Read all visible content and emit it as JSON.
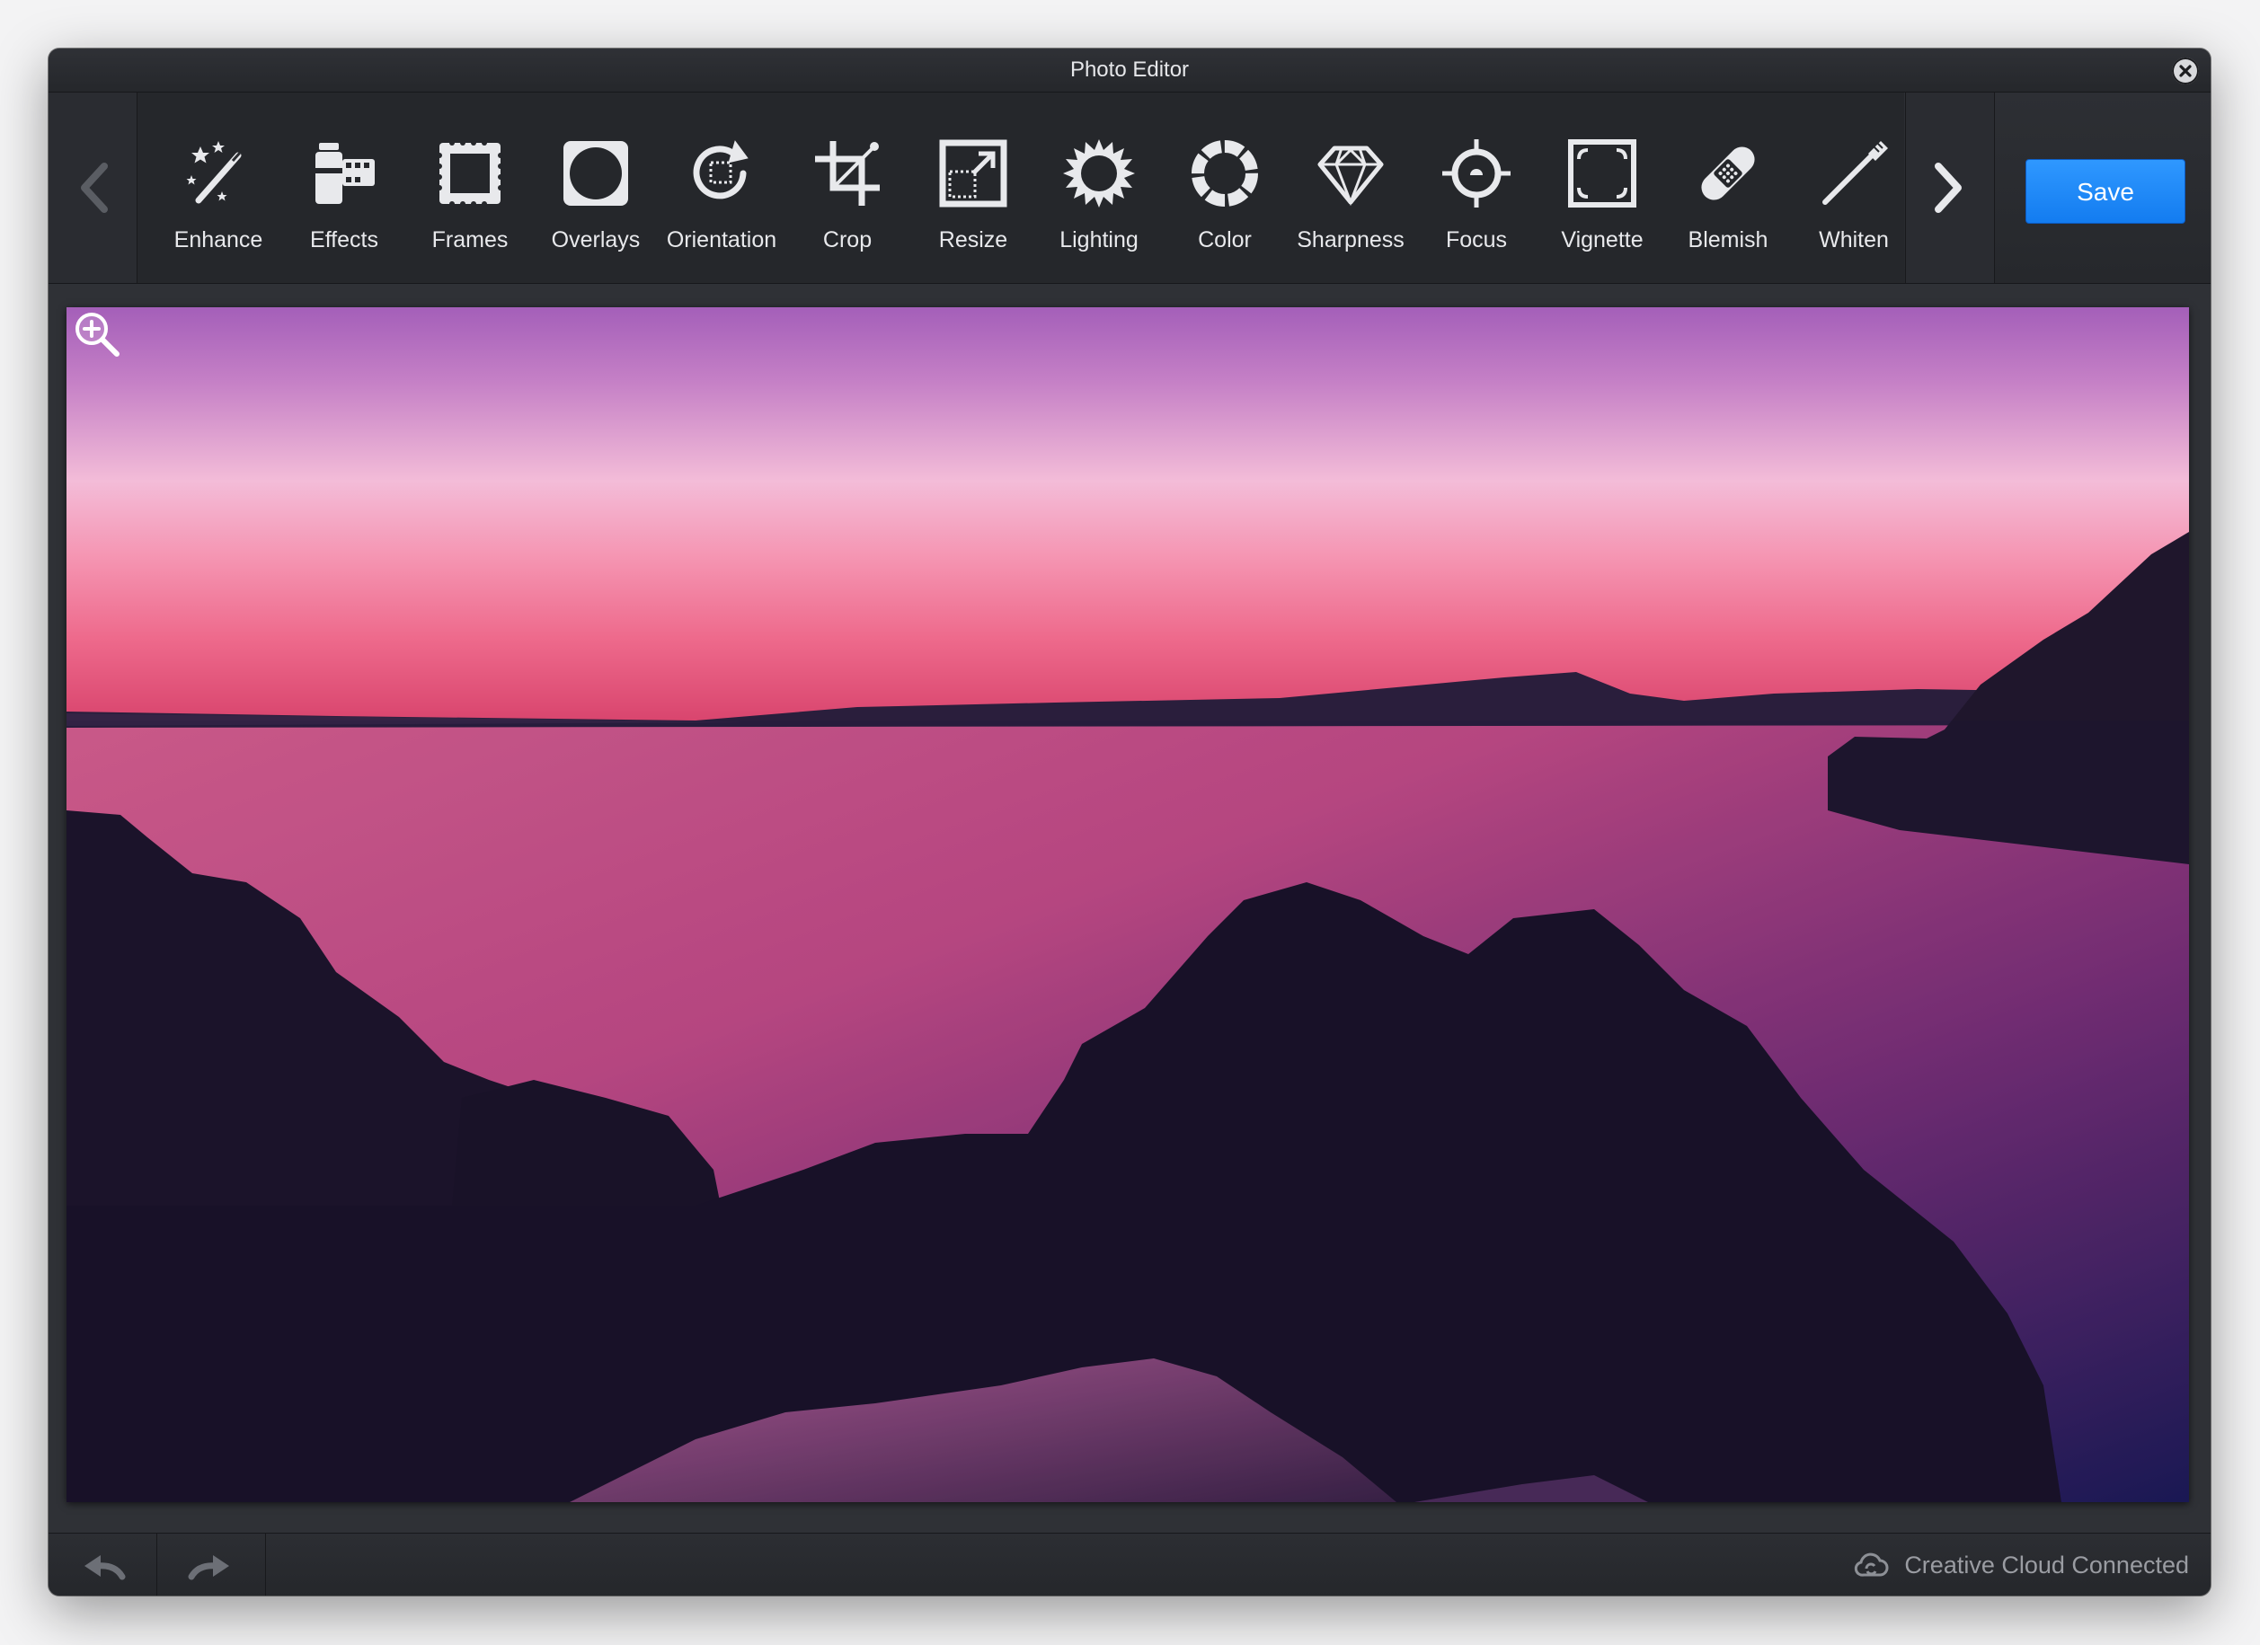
{
  "window": {
    "title": "Photo Editor"
  },
  "toolbar": {
    "tools": [
      {
        "label": "Enhance",
        "icon": "magic-wand-icon"
      },
      {
        "label": "Effects",
        "icon": "film-canister-icon"
      },
      {
        "label": "Frames",
        "icon": "frame-icon"
      },
      {
        "label": "Overlays",
        "icon": "overlay-icon"
      },
      {
        "label": "Orientation",
        "icon": "rotate-icon"
      },
      {
        "label": "Crop",
        "icon": "crop-icon"
      },
      {
        "label": "Resize",
        "icon": "resize-icon"
      },
      {
        "label": "Lighting",
        "icon": "sun-icon"
      },
      {
        "label": "Color",
        "icon": "color-wheel-icon"
      },
      {
        "label": "Sharpness",
        "icon": "diamond-icon"
      },
      {
        "label": "Focus",
        "icon": "target-icon"
      },
      {
        "label": "Vignette",
        "icon": "vignette-icon"
      },
      {
        "label": "Blemish",
        "icon": "bandage-icon"
      },
      {
        "label": "Whiten",
        "icon": "toothbrush-icon"
      }
    ],
    "save_label": "Save"
  },
  "status": {
    "cloud_label": "Creative Cloud Connected"
  },
  "colors": {
    "accent": "#1a86f7",
    "background": "#2b2d31",
    "text": "#e8e9ec"
  }
}
